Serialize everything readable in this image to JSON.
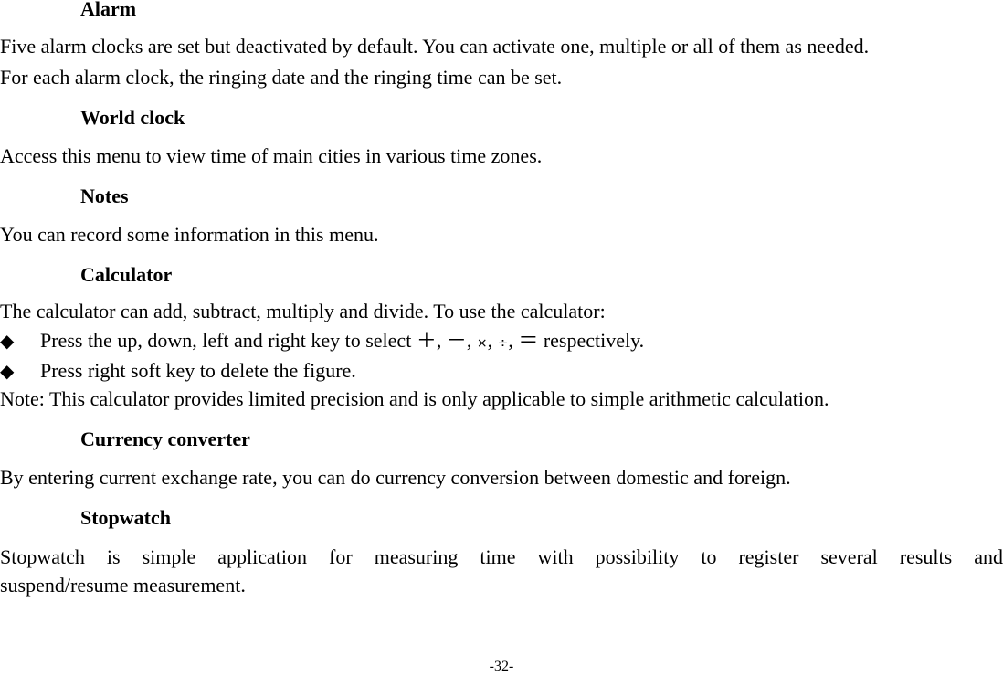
{
  "sections": {
    "alarm": {
      "heading": "Alarm",
      "lines": [
        "Five alarm clocks are set but deactivated by default. You can activate one, multiple or all of them as needed.",
        "For each alarm clock, the ringing date and the ringing time can be set."
      ]
    },
    "world_clock": {
      "heading": "World clock",
      "lines": [
        "Access this menu to view time of main cities in various time zones."
      ]
    },
    "notes": {
      "heading": "Notes",
      "lines": [
        "You can record some information in this menu."
      ]
    },
    "calculator": {
      "heading": "Calculator",
      "intro": "The calculator can add, subtract, multiply and divide. To use the calculator:",
      "bullet1": {
        "icon": "◆",
        "prefix": "Press the up, down, left and right key to select",
        "plus": "＋",
        "minus": "－",
        "times": "×",
        "divide": "÷",
        "equals": "＝",
        "suffix": "respectively."
      },
      "bullet2": {
        "icon": "◆",
        "text": "Press right soft key to delete the figure."
      },
      "note": "Note: This calculator provides limited precision and is only applicable to simple arithmetic calculation."
    },
    "currency_converter": {
      "heading": "Currency converter",
      "lines": [
        "By entering current exchange rate, you can do currency conversion between domestic and foreign."
      ]
    },
    "stopwatch": {
      "heading": "Stopwatch",
      "lines": [
        "Stopwatch is simple application for measuring time with possibility to register several results and",
        "suspend/resume measurement."
      ]
    }
  },
  "page_number": "-32-"
}
